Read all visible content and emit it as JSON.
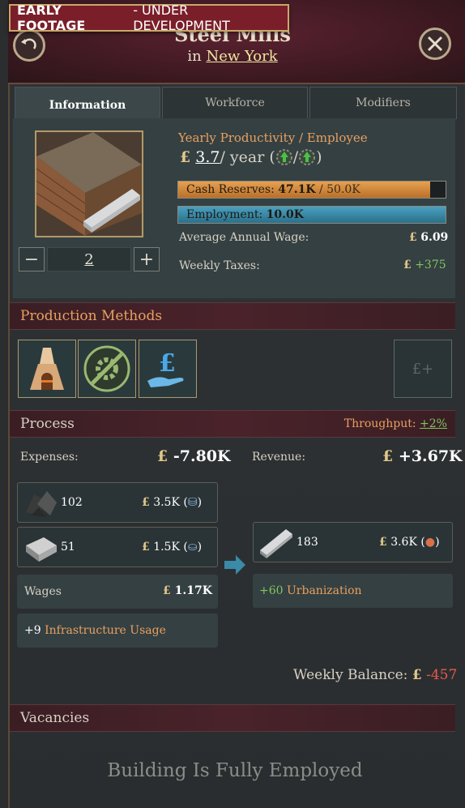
{
  "banner": {
    "strong": "EARLY FOOTAGE",
    "rest": " - UNDER DEVELOPMENT"
  },
  "header": {
    "title": "Steel Mills",
    "location_prefix": "in ",
    "location": "New York"
  },
  "tabs": [
    {
      "label": "Information",
      "active": true
    },
    {
      "label": "Workforce"
    },
    {
      "label": "Modifiers"
    }
  ],
  "info": {
    "productivity_label": "Yearly Productivity / Employee",
    "pound": "£",
    "productivity_value": "3.7",
    "productivity_unit": " / year (",
    "productivity_sep": " / ",
    "productivity_close": ")",
    "cash_label": "Cash Reserves: ",
    "cash_value": "47.1K",
    "cash_max": "  / 50.0K",
    "cash_fill": 0.942,
    "employment_label": "Employment: ",
    "employment_value": "10.0K",
    "employment_fill": 1.0,
    "wage_label": "Average Annual Wage:",
    "wage_value": "6.09",
    "taxes_label": "Weekly Taxes:",
    "taxes_value": "+375",
    "level": "2",
    "minus": "−",
    "plus": "+"
  },
  "production": {
    "title": "Production Methods",
    "empty_slot_glyph": "£+"
  },
  "process": {
    "title": "Process",
    "throughput_label": "Throughput: ",
    "throughput_value": "+2%",
    "expenses_label": "Expenses:",
    "expenses_value": "-7.80K",
    "revenue_label": "Revenue:",
    "revenue_value": "+3.67K",
    "inputs": [
      {
        "good": "coal",
        "amount": "102",
        "cost": "3.5K",
        "paren_open": " (",
        "paren_close": ")"
      },
      {
        "good": "iron",
        "amount": "51",
        "cost": "1.5K",
        "paren_open": " (",
        "paren_close": ")"
      }
    ],
    "output": {
      "good": "steel",
      "amount": "183",
      "value": "3.6K",
      "paren_open": " (",
      "paren_close": ")"
    },
    "wages_label": "Wages",
    "wages_value": "1.17K",
    "infra_value": "+9",
    "infra_label": " Infrastructure Usage",
    "urban_value": "+60",
    "urban_label": " Urbanization",
    "balance_label": "Weekly Balance: ",
    "balance_value": "-457"
  },
  "vacancies": {
    "title": "Vacancies",
    "message": "Building Is Fully Employed"
  },
  "colors": {
    "accent_orange": "#e8a060",
    "positive_green": "#7ec860",
    "negative_red": "#e85a50",
    "cash_bar": "#d08a3a",
    "employment_bar": "#3a8aa8"
  },
  "icons": {
    "back": "back-arrow-icon",
    "close": "close-x-icon",
    "trend_up": "up-arrow-gear-icon",
    "furnace": "blast-furnace-icon",
    "no_automation": "no-automation-gear-icon",
    "privately_owned": "hand-pound-icon"
  }
}
